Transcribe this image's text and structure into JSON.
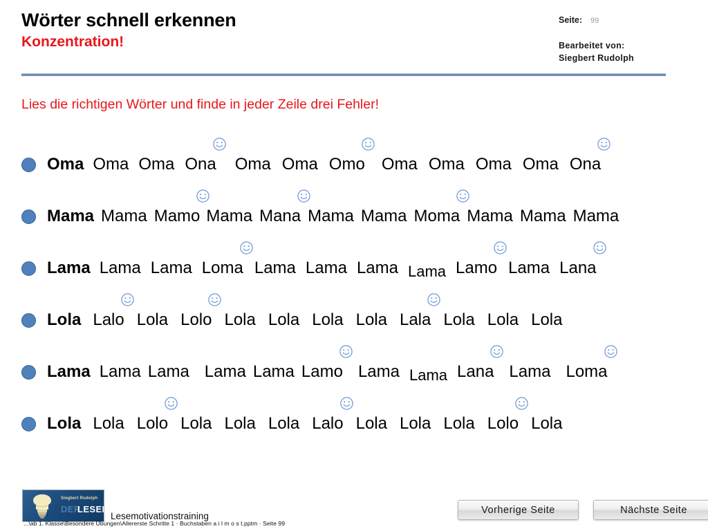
{
  "header": {
    "title": "Wörter schnell erkennen",
    "subtitle": "Konzentration!",
    "seite_label": "Seite:",
    "seite_value": "99",
    "editor_label": "Bearbeitet  von:",
    "editor_name": "Siegbert  Rudolph",
    "rule_color": "#6f8db0"
  },
  "instruction": {
    "text": "Lies die richtigen Wörter und finde in jeder Zeile drei Fehler!",
    "color": "#e8161c"
  },
  "exercise": {
    "bullet_color": "#4f81bd",
    "smiley_color": "#6f9ad3",
    "rows": [
      {
        "id": "row-oma",
        "words": [
          {
            "text": "Oma",
            "error": false,
            "gap": 13
          },
          {
            "text": "Oma",
            "error": false,
            "gap": 14
          },
          {
            "text": "Oma",
            "error": false,
            "gap": 15
          },
          {
            "text": "Ona",
            "error": true,
            "gap": 27
          },
          {
            "text": "Oma",
            "error": false,
            "gap": 16
          },
          {
            "text": "Oma",
            "error": false,
            "gap": 16
          },
          {
            "text": "Omo",
            "error": true,
            "gap": 24
          },
          {
            "text": "Oma",
            "error": false,
            "gap": 16
          },
          {
            "text": "Oma",
            "error": false,
            "gap": 16
          },
          {
            "text": "Oma",
            "error": false,
            "gap": 16
          },
          {
            "text": "Oma",
            "error": false,
            "gap": 16
          },
          {
            "text": "Ona",
            "error": true,
            "gap": 0
          }
        ]
      },
      {
        "id": "row-mama",
        "words": [
          {
            "text": "Mama",
            "error": false,
            "gap": 10
          },
          {
            "text": "Mama",
            "error": false,
            "gap": 10
          },
          {
            "text": "Mamo",
            "error": true,
            "gap": 9
          },
          {
            "text": "Mama",
            "error": false,
            "gap": 10
          },
          {
            "text": "Mana",
            "error": true,
            "gap": 10
          },
          {
            "text": "Mama",
            "error": false,
            "gap": 10
          },
          {
            "text": "Mama",
            "error": false,
            "gap": 10
          },
          {
            "text": "Moma",
            "error": true,
            "gap": 10
          },
          {
            "text": "Mama",
            "error": false,
            "gap": 10
          },
          {
            "text": "Mama",
            "error": false,
            "gap": 10
          },
          {
            "text": "Mama",
            "error": false,
            "gap": 0
          }
        ]
      },
      {
        "id": "row-lama-1",
        "words": [
          {
            "text": "Lama",
            "error": false,
            "gap": 13
          },
          {
            "text": "Lama",
            "error": false,
            "gap": 14
          },
          {
            "text": "Lama",
            "error": false,
            "gap": 14
          },
          {
            "text": "Loma",
            "error": true,
            "gap": 16
          },
          {
            "text": "Lama",
            "error": false,
            "gap": 14
          },
          {
            "text": "Lama",
            "error": false,
            "gap": 14
          },
          {
            "text": "Lama",
            "error": false,
            "gap": 14
          },
          {
            "text": "Lama",
            "error": false,
            "gap": 14,
            "lowered": true
          },
          {
            "text": "Lamo",
            "error": true,
            "gap": 16
          },
          {
            "text": "Lama",
            "error": false,
            "gap": 14
          },
          {
            "text": "Lana",
            "error": true,
            "gap": 0
          }
        ]
      },
      {
        "id": "row-lola-1",
        "words": [
          {
            "text": "Lola",
            "error": false,
            "gap": 17
          },
          {
            "text": "Lalo",
            "error": true,
            "gap": 18
          },
          {
            "text": "Lola",
            "error": false,
            "gap": 18
          },
          {
            "text": "Lolo",
            "error": true,
            "gap": 18
          },
          {
            "text": "Lola",
            "error": false,
            "gap": 18
          },
          {
            "text": "Lola",
            "error": false,
            "gap": 18
          },
          {
            "text": "Lola",
            "error": false,
            "gap": 18
          },
          {
            "text": "Lola",
            "error": false,
            "gap": 18
          },
          {
            "text": "Lala",
            "error": true,
            "gap": 18
          },
          {
            "text": "Lola",
            "error": false,
            "gap": 18
          },
          {
            "text": "Lola",
            "error": false,
            "gap": 18
          },
          {
            "text": "Lola",
            "error": false,
            "gap": 0
          }
        ]
      },
      {
        "id": "row-lama-2",
        "words": [
          {
            "text": "Lama",
            "error": false,
            "gap": 13
          },
          {
            "text": "Lama",
            "error": false,
            "gap": 10
          },
          {
            "text": "Lama",
            "error": false,
            "gap": 22
          },
          {
            "text": "Lama",
            "error": false,
            "gap": 10
          },
          {
            "text": "Lama",
            "error": false,
            "gap": 10
          },
          {
            "text": "Lamo",
            "error": true,
            "gap": 22
          },
          {
            "text": "Lama",
            "error": false,
            "gap": 14
          },
          {
            "text": "Lama",
            "error": false,
            "gap": 14,
            "lowered": true
          },
          {
            "text": "Lana",
            "error": true,
            "gap": 22
          },
          {
            "text": "Lama",
            "error": false,
            "gap": 22
          },
          {
            "text": "Loma",
            "error": true,
            "gap": 0
          }
        ]
      },
      {
        "id": "row-lola-2",
        "words": [
          {
            "text": "Lola",
            "error": false,
            "gap": 17
          },
          {
            "text": "Lola",
            "error": false,
            "gap": 18
          },
          {
            "text": "Lolo",
            "error": true,
            "gap": 18
          },
          {
            "text": "Lola",
            "error": false,
            "gap": 18
          },
          {
            "text": "Lola",
            "error": false,
            "gap": 18
          },
          {
            "text": "Lola",
            "error": false,
            "gap": 18
          },
          {
            "text": "Lalo",
            "error": true,
            "gap": 18
          },
          {
            "text": "Lola",
            "error": false,
            "gap": 18
          },
          {
            "text": "Lola",
            "error": false,
            "gap": 18
          },
          {
            "text": "Lola",
            "error": false,
            "gap": 18
          },
          {
            "text": "Lolo",
            "error": true,
            "gap": 18
          },
          {
            "text": "Lola",
            "error": false,
            "gap": 0
          }
        ]
      }
    ]
  },
  "footer": {
    "logo_author": "Siegbert Rudolph",
    "logo_der": "DER",
    "logo_lesekoch": "LESEKOCH",
    "brand_title": "Lesemotivationstraining",
    "path": "...\\ab 1. Klasse\\Besondere Übungen\\Allererste Schritte 1 · Buchstaben a i l m o s t.pptm · Seite 99",
    "prev_button": "Vorherige  Seite",
    "next_button": "Nächste  Seite"
  }
}
